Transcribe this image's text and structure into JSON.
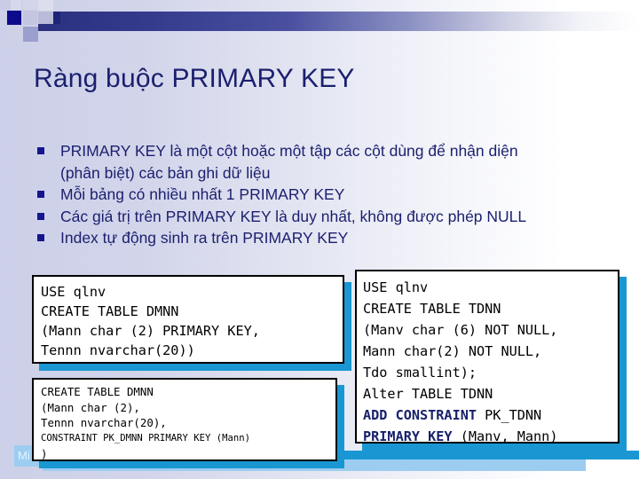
{
  "slide": {
    "title": "Ràng buộc PRIMARY KEY",
    "accent_navy": "#1b1f6e",
    "accent_blue": "#1a97d2",
    "bullet_color": "#15158e"
  },
  "bullets": [
    {
      "line1": "PRIMARY KEY là một cột hoặc một tập các cột dùng để nhận diện",
      "line2": "(phân biệt) các bản ghi dữ liệu"
    },
    {
      "line1": "Mỗi bảng có nhiều nhất 1 PRIMARY KEY",
      "line2": ""
    },
    {
      "line1": "Các giá trị trên PRIMARY KEY là duy nhất, không được phép NULL",
      "line2": ""
    },
    {
      "line1": "Index tự động sinh ra trên PRIMARY KEY",
      "line2": ""
    }
  ],
  "code_left_top": {
    "lines": [
      "USE qlnv",
      "CREATE TABLE DMNN",
      "(Mann char (2) PRIMARY KEY,",
      " Tennn nvarchar(20))"
    ]
  },
  "code_left_bottom": {
    "lines": [
      "CREATE TABLE DMNN",
      "(Mann char (2),",
      " Tennn nvarchar(20),"
    ],
    "small_line": "  CONSTRAINT PK_DMNN PRIMARY KEY (Mann)",
    "close_line": ")"
  },
  "code_right": {
    "line1": "USE qlnv",
    "line2": "CREATE TABLE TDNN",
    "line3": "(Manv char (6) NOT NULL,",
    "line4": " Mann char(2) NOT NULL,",
    "line5": " Tdo smallint);",
    "line6": "Alter TABLE TDNN",
    "line7_kw": "ADD CONSTRAINT",
    "line7_rest": " PK_TDNN",
    "line8_kw": "PRIMARY KEY",
    "line8_rest": " (Manv, Mann)"
  },
  "footer": {
    "tag_text": "Mi"
  }
}
